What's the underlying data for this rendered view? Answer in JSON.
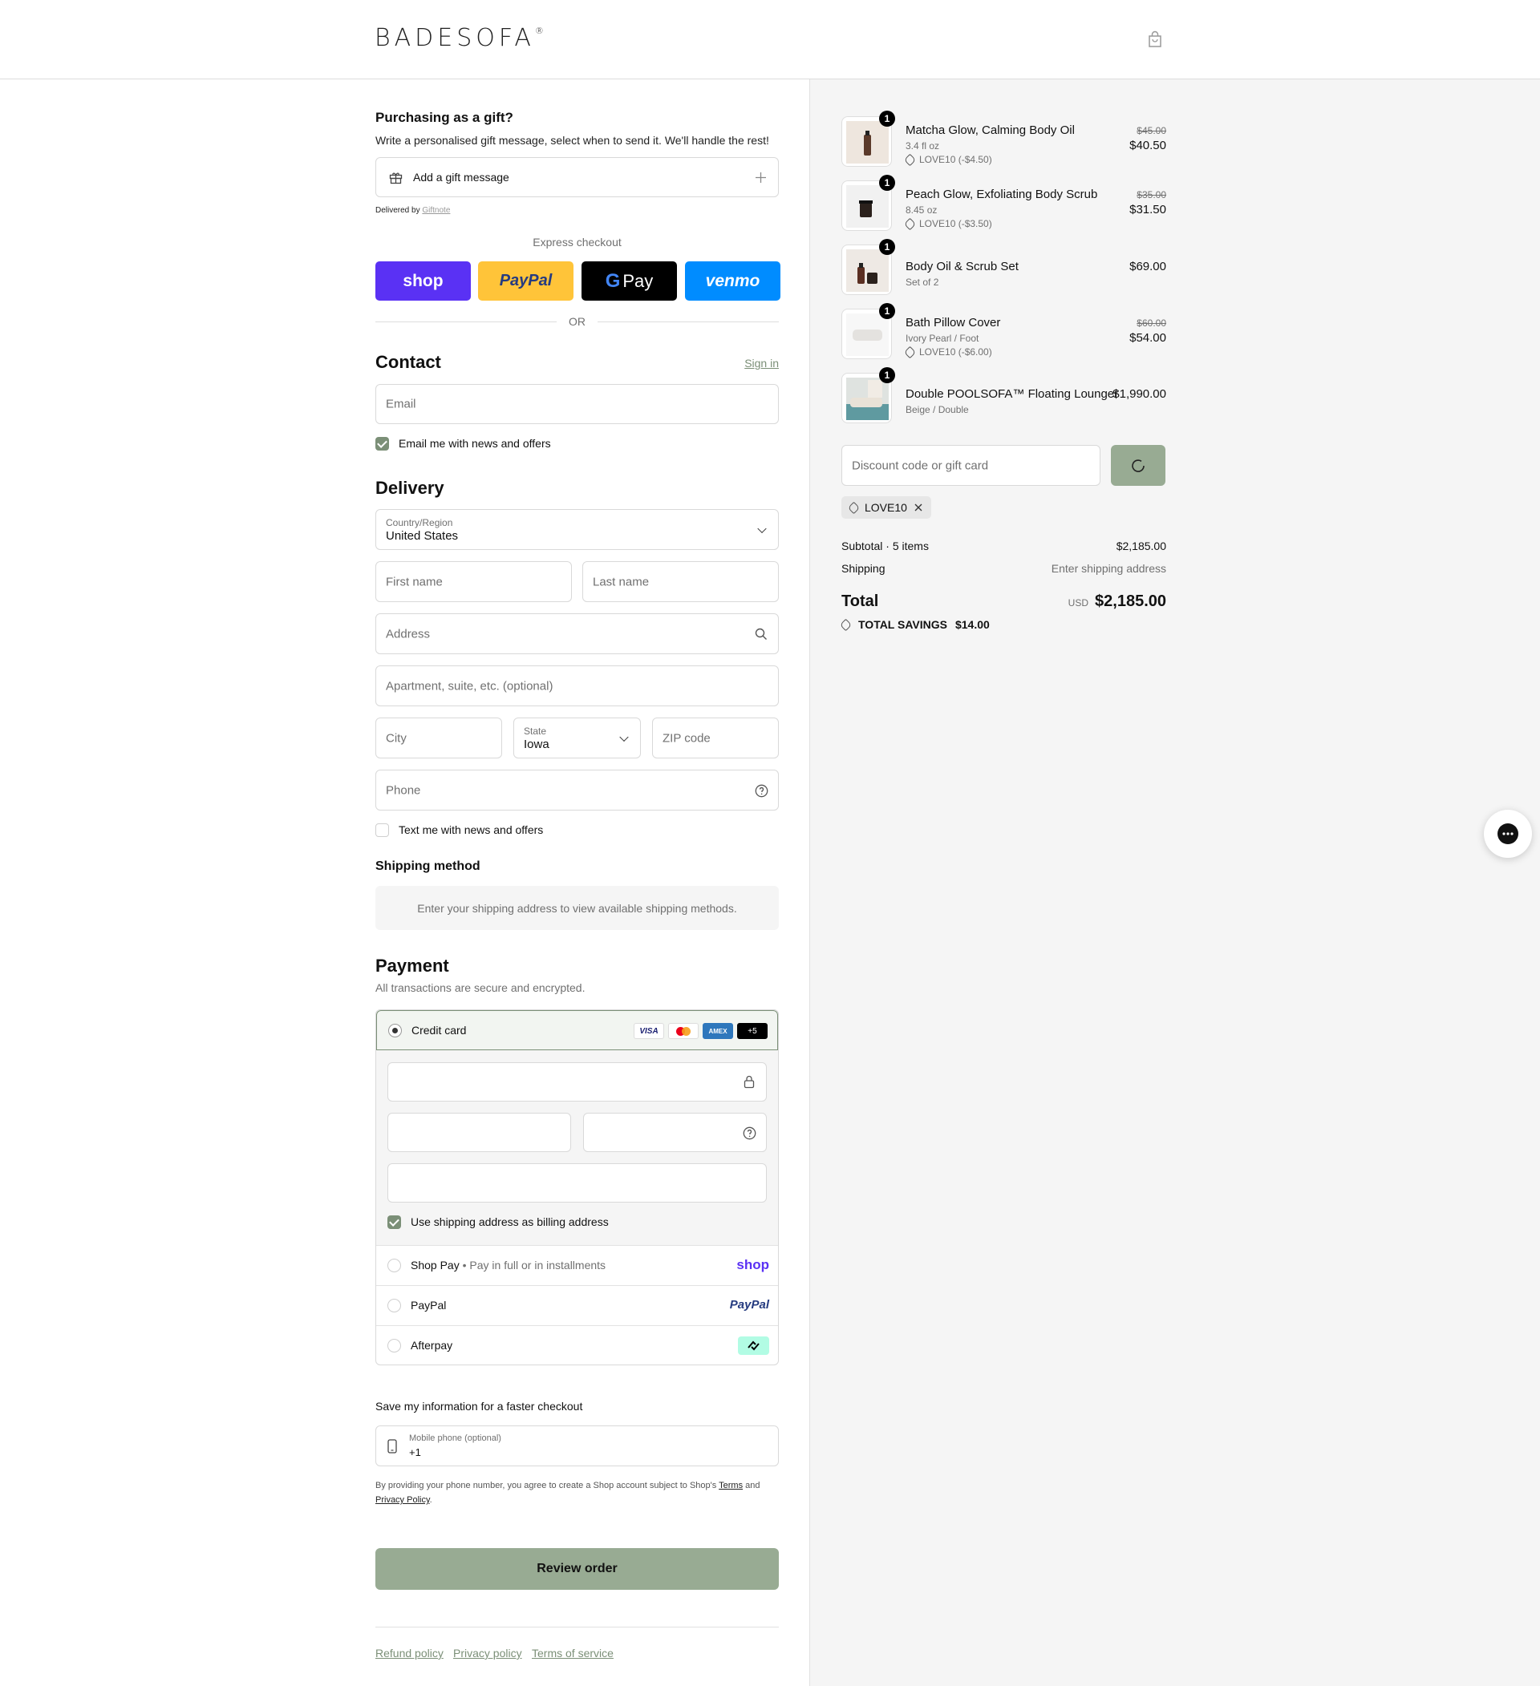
{
  "header": {
    "logo": "BADESOFA",
    "logo_mark": "®"
  },
  "gift": {
    "title": "Purchasing as a gift?",
    "subtitle": "Write a personalised gift message, select when to send it. We'll handle the rest!",
    "button_label": "Add a gift message",
    "delivered_by": "Delivered by",
    "delivered_link": "Giftnote"
  },
  "express": {
    "label": "Express checkout",
    "buttons": [
      "shop",
      "PayPal",
      "Pay",
      "venmo"
    ],
    "or": "OR"
  },
  "contact": {
    "title": "Contact",
    "sign_in": "Sign in",
    "email_placeholder": "Email",
    "news_label": "Email me with news and offers",
    "news_checked": true
  },
  "delivery": {
    "title": "Delivery",
    "country_label": "Country/Region",
    "country_value": "United States",
    "first_name": "First name",
    "last_name": "Last name",
    "address": "Address",
    "apartment": "Apartment, suite, etc. (optional)",
    "city": "City",
    "state_label": "State",
    "state_value": "Iowa",
    "zip": "ZIP code",
    "phone": "Phone",
    "text_label": "Text me with news and offers",
    "text_checked": false
  },
  "shipping": {
    "title": "Shipping method",
    "message": "Enter your shipping address to view available shipping methods."
  },
  "payment": {
    "title": "Payment",
    "subtitle": "All transactions are secure and encrypted.",
    "credit_card": "Credit card",
    "card_badges": [
      "VISA",
      "",
      "AMEX",
      "+5"
    ],
    "billing_label": "Use shipping address as billing address",
    "billing_checked": true,
    "shop_pay": "Shop Pay",
    "shop_pay_sub": "Pay in full or in installments",
    "shop_logo": "shop",
    "paypal": "PayPal",
    "paypal_logo": "PayPal",
    "afterpay": "Afterpay"
  },
  "save_info": {
    "title": "Save my information for a faster checkout",
    "mobile_label": "Mobile phone (optional)",
    "mobile_value": "+1",
    "legal_1": "By providing your phone number, you agree to create a Shop account subject to Shop's",
    "terms": "Terms",
    "and": "and",
    "privacy": "Privacy Policy",
    "period": "."
  },
  "review_button": "Review order",
  "footer": [
    "Refund policy",
    "Privacy policy",
    "Terms of service"
  ],
  "cart": {
    "items": [
      {
        "qty": "1",
        "name": "Matcha Glow, Calming Body Oil",
        "variant": "3.4 fl oz",
        "discount": "LOVE10 (-$4.50)",
        "old_price": "$45.00",
        "price": "$40.50"
      },
      {
        "qty": "1",
        "name": "Peach Glow, Exfoliating Body Scrub",
        "variant": "8.45 oz",
        "discount": "LOVE10 (-$3.50)",
        "old_price": "$35.00",
        "price": "$31.50"
      },
      {
        "qty": "1",
        "name": "Body Oil & Scrub Set",
        "variant": "Set of 2",
        "discount": "",
        "old_price": "",
        "price": "$69.00"
      },
      {
        "qty": "1",
        "name": "Bath Pillow Cover",
        "variant": "Ivory Pearl / Foot",
        "discount": "LOVE10 (-$6.00)",
        "old_price": "$60.00",
        "price": "$54.00"
      },
      {
        "qty": "1",
        "name": "Double POOLSOFA™ Floating Lounger",
        "variant": "Beige / Double",
        "discount": "",
        "old_price": "",
        "price": "$1,990.00"
      }
    ],
    "discount_placeholder": "Discount code or gift card",
    "applied_code": "LOVE10",
    "subtotal_label": "Subtotal · 5 items",
    "subtotal_value": "$2,185.00",
    "shipping_label": "Shipping",
    "shipping_value": "Enter shipping address",
    "total_label": "Total",
    "currency": "USD",
    "total_value": "$2,185.00",
    "savings_label": "TOTAL SAVINGS",
    "savings_value": "$14.00"
  },
  "colors": {
    "accent": "#7b8f77",
    "button": "#98ab93",
    "shop": "#5a31f4",
    "paypal_yellow": "#ffc439",
    "venmo": "#008cff"
  }
}
